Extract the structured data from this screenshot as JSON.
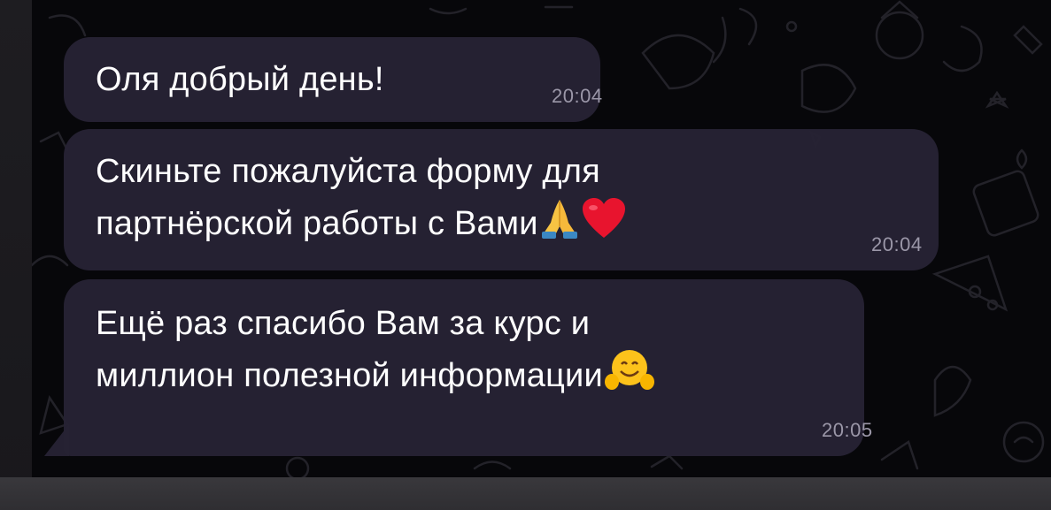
{
  "messages": [
    {
      "lines": [
        "Оля добрый день!"
      ],
      "time": "20:04",
      "emojis": []
    },
    {
      "lines": [
        "Скиньте пожалуйста форму для",
        "партнёрской работы с Вами"
      ],
      "time": "20:04",
      "emojis": [
        "folded-hands",
        "red-heart"
      ]
    },
    {
      "lines": [
        "Ещё раз спасибо Вам за курс и",
        "миллион полезной информации"
      ],
      "time": "20:05",
      "emojis": [
        "hugging-face"
      ]
    }
  ],
  "colors": {
    "bubble": "#262234",
    "text": "#ffffff",
    "time": "#9b97a8",
    "wallpaper": "#07070a"
  }
}
